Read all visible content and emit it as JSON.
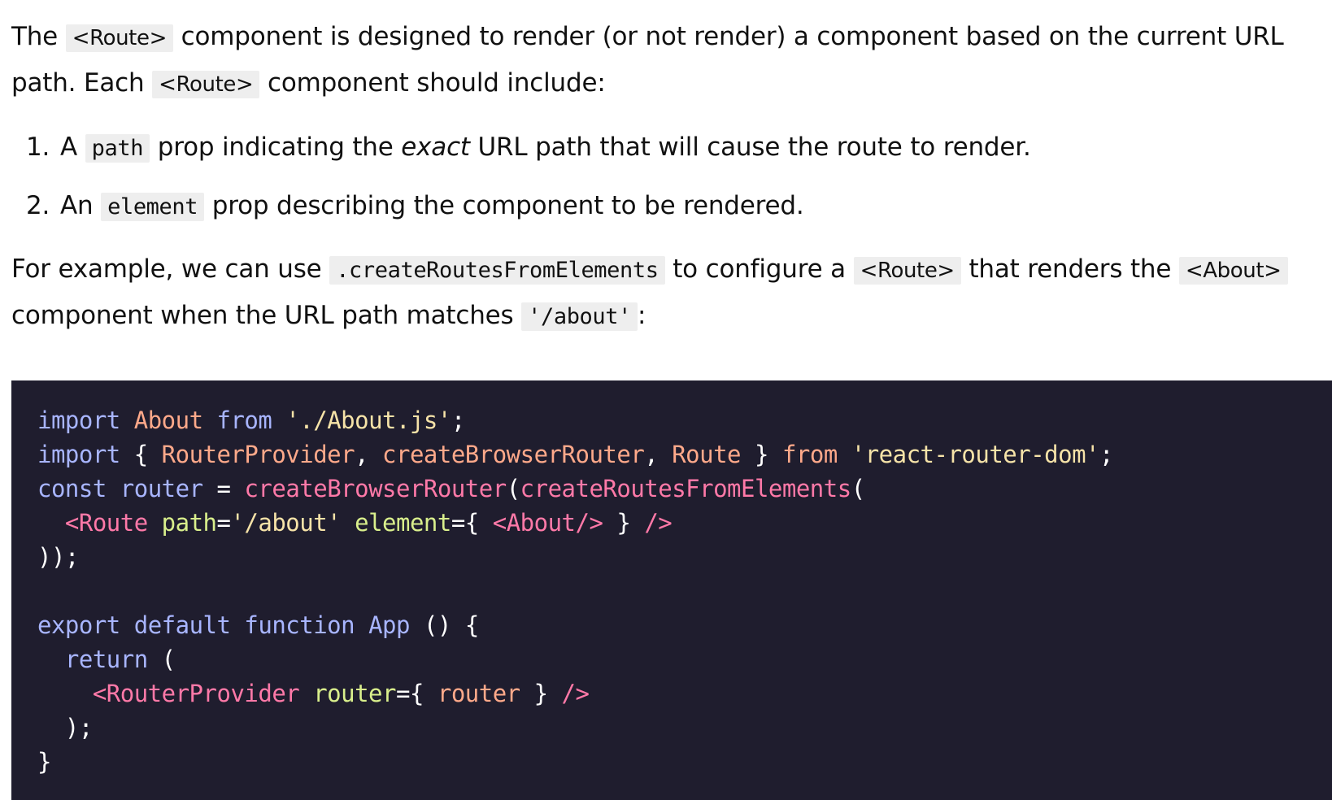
{
  "intro": {
    "p1_a": "The ",
    "p1_code1": "<Route>",
    "p1_b": " component is designed to render (or not render) a component based on the current URL path. Each ",
    "p1_code2": "<Route>",
    "p1_c": " component should include:"
  },
  "list": [
    {
      "num": "1.",
      "a": "A ",
      "code": "path",
      "b": " prop indicating the ",
      "em": "exact",
      "c": " URL path that will cause the route to render."
    },
    {
      "num": "2.",
      "a": "An ",
      "code": "element",
      "b": " prop describing the component to be rendered."
    }
  ],
  "example": {
    "a": "For example, we can use ",
    "code1": ".createRoutesFromElements",
    "b": " to configure a ",
    "code2": "<Route>",
    "c": " that renders the ",
    "code3": "<About>",
    "d": " component when the URL path matches ",
    "code4": "'/about'",
    "e": ":"
  },
  "code": {
    "l1": {
      "kw1": "import",
      "id1": "About",
      "kw2": "from",
      "st1": "'./About.js'",
      "pn1": ";"
    },
    "l2": {
      "kw1": "import",
      "pn1": "{",
      "id1": "RouterProvider",
      "pn2": ",",
      "id2": "createBrowserRouter",
      "pn3": ",",
      "id3": "Route",
      "pn4": "}",
      "kw2": "from",
      "st1": "'react-router-dom'",
      "pn5": ";"
    },
    "l3": {
      "kw1": "const",
      "kw2": "router",
      "pn1": "=",
      "id1": "createBrowserRouter",
      "pn2": "(",
      "id2": "createRoutesFromElements",
      "pn3": "("
    },
    "l4": {
      "tg1": "<Route",
      "at1": "path",
      "pn1": "=",
      "st1": "'/about'",
      "at2": "element",
      "pn2": "={",
      "tg2": "<About/>",
      "pn3": "}",
      "tg3": "/>"
    },
    "l5": {
      "pn1": "));"
    },
    "l6": {
      "kw1": "export",
      "kw2": "default",
      "kw3": "function",
      "kw4": "App",
      "pn1": "() {"
    },
    "l7": {
      "kw1": "return",
      "pn1": "("
    },
    "l8": {
      "tg1": "<RouterProvider",
      "at1": "router",
      "pn1": "={",
      "id1": "router",
      "pn2": "}",
      "tg2": "/>"
    },
    "l9": {
      "pn1": ");"
    },
    "l10": {
      "pn1": "}"
    }
  }
}
